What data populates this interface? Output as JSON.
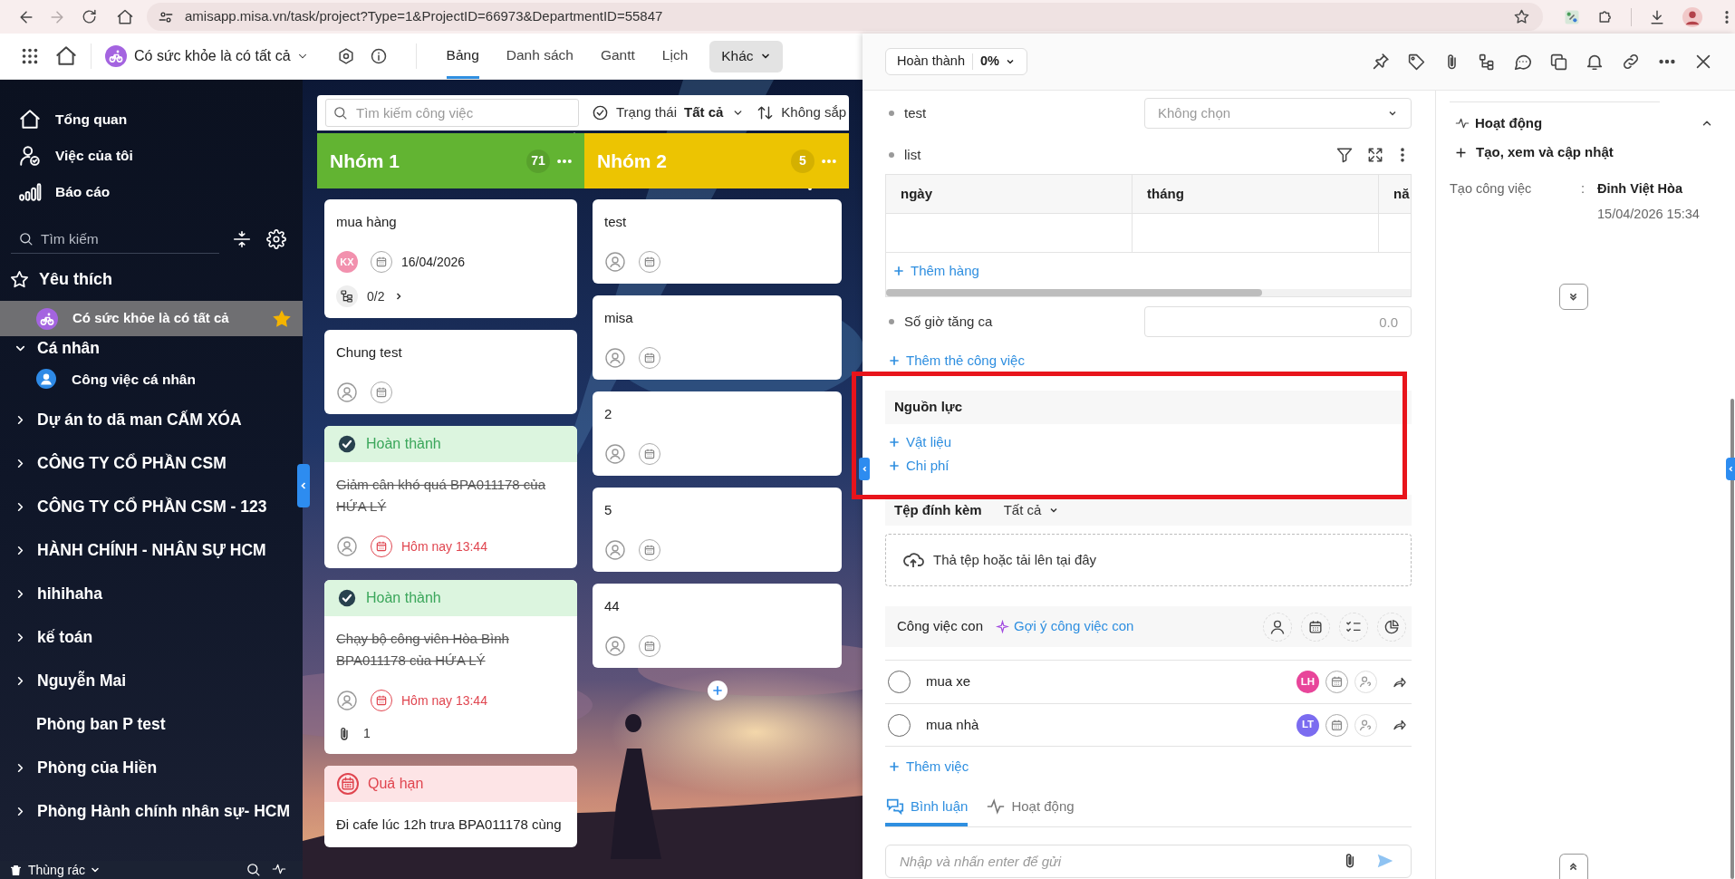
{
  "browser": {
    "url": "amisapp.misa.vn/task/project?Type=1&ProjectID=66973&DepartmentID=55847"
  },
  "header": {
    "project": "Có sức khỏe là có tất cả",
    "tabs": [
      {
        "label": "Bảng",
        "selected": true
      },
      {
        "label": "Danh sách",
        "selected": false
      },
      {
        "label": "Gantt",
        "selected": false
      },
      {
        "label": "Lịch",
        "selected": false
      }
    ],
    "more": "Khác"
  },
  "sidebar": {
    "nav": [
      {
        "label": "Tổng quan",
        "kind": "home"
      },
      {
        "label": "Việc của tôi",
        "kind": "mytasks"
      },
      {
        "label": "Báo cáo",
        "kind": "report"
      }
    ],
    "search": {
      "placeholder": "Tìm kiếm"
    },
    "favorites": {
      "title": "Yêu thích",
      "items": [
        {
          "label": "Có sức khỏe là có tất cả",
          "selected": true,
          "starred": true
        }
      ]
    },
    "groups": [
      {
        "label": "Cá nhân",
        "kind": "group",
        "expanded": true,
        "children": [
          {
            "label": "Công việc cá nhân"
          }
        ]
      },
      {
        "label": "Dự án to dã man CẤM XÓA",
        "kind": "group",
        "expanded": false
      },
      {
        "label": "CÔNG TY CỔ PHẦN CSM",
        "kind": "group",
        "expanded": false
      },
      {
        "label": "CÔNG TY CỔ PHẦN CSM - 123",
        "kind": "group",
        "expanded": false
      },
      {
        "label": "HÀNH CHÍNH - NHÂN SỰ HCM",
        "kind": "group",
        "expanded": false
      },
      {
        "label": "hihihaha",
        "kind": "group",
        "expanded": false
      },
      {
        "label": "kế toán",
        "kind": "group",
        "expanded": false
      },
      {
        "label": "Nguyễn Mai",
        "kind": "group",
        "expanded": false
      },
      {
        "label": "Phòng ban P test",
        "kind": "plain"
      },
      {
        "label": "Phòng của Hiền",
        "kind": "group",
        "expanded": false
      },
      {
        "label": "Phòng Hành chính nhân sự- HCM",
        "kind": "group",
        "expanded": false
      }
    ],
    "footer": "Thùng rác"
  },
  "board": {
    "search": {
      "placeholder": "Tìm kiếm công việc"
    },
    "filter": {
      "label": "Trạng thái",
      "value": "Tất cả"
    },
    "sort": "Không sắp",
    "columns": [
      {
        "title": "Nhóm 1",
        "count": "71",
        "color": "#62b432",
        "cards": [
          {
            "title": "mua hàng",
            "done": false,
            "meta": true,
            "assignee": {
              "initials": "KX",
              "color": "#f291ae"
            },
            "due": {
              "text": "16/04/2026",
              "overdue": false
            },
            "subtasks": "0/2"
          },
          {
            "title": "Chung test",
            "done": false,
            "meta": true
          },
          {
            "banner": {
              "kind": "done",
              "label": "Hoàn thành"
            },
            "title": "Giảm cân khó quá BPA011178 của HỨA LÝ",
            "done": true,
            "meta": true,
            "due": {
              "text": "Hôm nay 13:44",
              "overdue": true
            }
          },
          {
            "banner": {
              "kind": "done",
              "label": "Hoàn thành"
            },
            "title": "Chạy bộ công viên Hòa Bình BPA011178 của HỨA LÝ",
            "done": true,
            "meta": true,
            "due": {
              "text": "Hôm nay 13:44",
              "overdue": true
            },
            "attachments": "1"
          },
          {
            "banner": {
              "kind": "overdue",
              "label": "Quá hạn"
            },
            "title": "Đi cafe lúc 12h trưa BPA011178 cùng",
            "done": false,
            "meta": false
          }
        ]
      },
      {
        "title": "Nhóm 2",
        "count": "5",
        "color": "#ecc402",
        "cards": [
          {
            "title": "test",
            "done": false,
            "meta": true
          },
          {
            "title": "misa",
            "done": false,
            "meta": true
          },
          {
            "title": "2",
            "done": false,
            "meta": true
          },
          {
            "title": "5",
            "done": false,
            "meta": true
          },
          {
            "title": "44",
            "done": false,
            "meta": true
          }
        ]
      }
    ]
  },
  "task_panel": {
    "status": {
      "label": "Hoàn thành",
      "value": "0%"
    },
    "fields": [
      {
        "kind": "select",
        "label": "test",
        "placeholder": "Không chọn"
      },
      {
        "kind": "table",
        "label": "list",
        "columns": [
          "ngày",
          "tháng",
          "nă"
        ],
        "add_row": "Thêm hàng"
      },
      {
        "kind": "number",
        "label": "Số giờ tăng ca",
        "placeholder": "0.0"
      }
    ],
    "add_field": "Thêm thẻ công việc",
    "resources": {
      "title": "Nguồn lực",
      "actions": [
        "Vật liệu",
        "Chi phí"
      ]
    },
    "attachments": {
      "title": "Tệp đính kèm",
      "filter": "Tất cả",
      "dropzone": "Thả tệp hoặc tải lên tại đây"
    },
    "subtasks": {
      "title": "Công việc con",
      "suggest": "Gợi ý công việc con",
      "items": [
        {
          "title": "mua xe",
          "done": false,
          "assignee": {
            "initials": "LH",
            "color": "#e8459a"
          }
        },
        {
          "title": "mua nhà",
          "done": false,
          "assignee": {
            "initials": "LT",
            "color": "#7b6cf0"
          }
        }
      ],
      "add": "Thêm việc"
    },
    "tabs": [
      {
        "label": "Bình luận",
        "kind": "comments",
        "selected": true
      },
      {
        "label": "Hoạt động",
        "kind": "activity",
        "selected": false
      }
    ],
    "comment": {
      "placeholder": "Nhập và nhấn enter để gửi"
    }
  },
  "activity": {
    "title": "Hoạt động",
    "expanded": true,
    "subtitle": "Tạo, xem và cập nhật",
    "entries": [
      {
        "action": "Tạo công việc",
        "separator": ":",
        "user": "Đinh Việt Hòa",
        "time": "15/04/2026 15:34"
      }
    ]
  }
}
